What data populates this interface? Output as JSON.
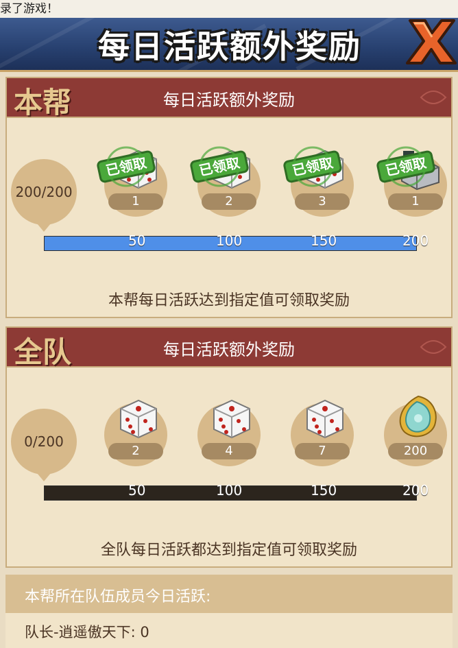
{
  "toast": "录了游戏！",
  "header": {
    "title": "每日活跃额外奖励"
  },
  "panels": [
    {
      "tab": "本帮",
      "title": "每日活跃额外奖励",
      "progress": "200/200",
      "progress_value": 200,
      "progress_max": 200,
      "bar_color": "#4f8fe8",
      "rewards": [
        {
          "icon": "dice-icon",
          "count": "1",
          "claimed": true,
          "stamp": "已领取"
        },
        {
          "icon": "dice-icon",
          "count": "2",
          "claimed": true,
          "stamp": "已领取"
        },
        {
          "icon": "dice-icon",
          "count": "3",
          "claimed": true,
          "stamp": "已领取"
        },
        {
          "icon": "treasure-icon",
          "count": "1",
          "claimed": true,
          "stamp": "已领取"
        }
      ],
      "ticks": [
        "50",
        "100",
        "150",
        "200"
      ],
      "description": "本帮每日活跃达到指定值可领取奖励"
    },
    {
      "tab": "全队",
      "title": "每日活跃额外奖励",
      "progress": "0/200",
      "progress_value": 0,
      "progress_max": 200,
      "bar_color": "#4f8fe8",
      "rewards": [
        {
          "icon": "dice-icon",
          "count": "2",
          "claimed": false
        },
        {
          "icon": "dice-icon",
          "count": "4",
          "claimed": false
        },
        {
          "icon": "dice-icon",
          "count": "7",
          "claimed": false
        },
        {
          "icon": "jade-icon",
          "count": "200",
          "claimed": false
        }
      ],
      "ticks": [
        "50",
        "100",
        "150",
        "200"
      ],
      "description": "全队每日活跃都达到指定值可领取奖励"
    }
  ],
  "members": {
    "header": "本帮所在队伍成员今日活跃:",
    "rows": [
      "队长-逍遥傲天下: 0"
    ]
  }
}
